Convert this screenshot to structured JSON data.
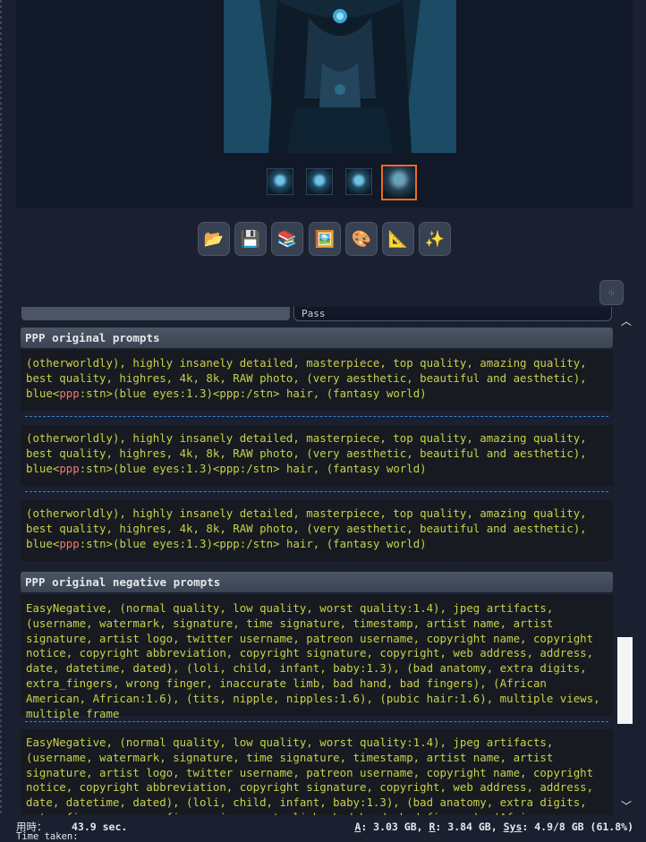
{
  "status": {
    "time_label": "用時：",
    "time_value": "43.9 sec.",
    "time_sub": "Time taken:",
    "mem_a_key": "A",
    "mem_a": ": 3.03 GB, ",
    "mem_r_key": "R",
    "mem_r": ": 3.84 GB, ",
    "mem_sys_key": "Sys",
    "mem_sys": ": 4.9/8 GB (61.8%)"
  },
  "toolbar": {
    "buttons": [
      {
        "name": "folder-icon",
        "glyph": "📂"
      },
      {
        "name": "save-icon",
        "glyph": "💾"
      },
      {
        "name": "zip-icon",
        "glyph": "📚"
      },
      {
        "name": "image-icon",
        "glyph": "🖼️"
      },
      {
        "name": "palette-icon",
        "glyph": "🎨"
      },
      {
        "name": "ruler-icon",
        "glyph": "📐"
      },
      {
        "name": "sparkles-icon",
        "glyph": "✨"
      }
    ],
    "corner_glyph": "⁘"
  },
  "top_input_fragment": "Pass",
  "sections": {
    "prompts_header": "PPP original prompts",
    "negative_header": "PPP original negative prompts"
  },
  "prompt": {
    "a": "(otherworldly), highly insanely detailed, masterpiece, top quality, amazing quality, best quality, highres, 4k, 8k, RAW photo, (very aesthetic, beautiful and aesthetic), blue",
    "tag_open": "<",
    "tag_name": "ppp",
    "tag_rest": ":stn>(blue eyes:1.3)<ppp:/stn> hair, (fantasy world)"
  },
  "negative": {
    "text": "EasyNegative, (normal quality, low quality, worst quality:1.4), jpeg artifacts, (username, watermark, signature, time signature, timestamp, artist name, artist signature, artist logo, twitter username, patreon username, copyright name, copyright notice, copyright abbreviation, copyright signature, copyright, web address, address, date, datetime, dated), (loli, child, infant, baby:1.3), (bad anatomy, extra digits, extra_fingers, wrong finger, inaccurate limb, bad hand, bad fingers), (African American, African:1.6), (tits, nipple, nipples:1.6), (pubic hair:1.6), multiple views, multiple frame"
  },
  "colors": {
    "accent_selected": "#f06a1e",
    "prompt_text": "#c8d24a",
    "tag_text": "#f07a73",
    "separator": "#3b82c6"
  }
}
